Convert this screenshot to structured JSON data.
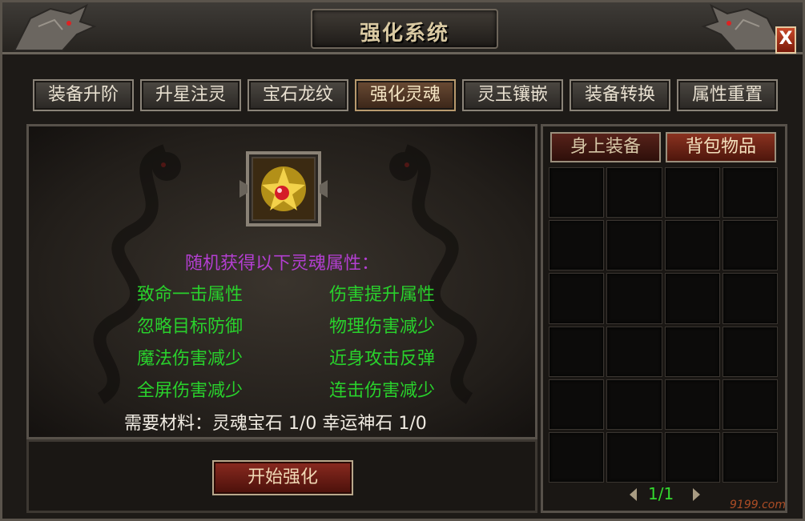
{
  "window": {
    "title": "强化系统",
    "close_label": "X"
  },
  "tabs": [
    {
      "label": "装备升阶",
      "active": false
    },
    {
      "label": "升星注灵",
      "active": false
    },
    {
      "label": "宝石龙纹",
      "active": false
    },
    {
      "label": "强化灵魂",
      "active": true
    },
    {
      "label": "灵玉镶嵌",
      "active": false
    },
    {
      "label": "装备转换",
      "active": false
    },
    {
      "label": "属性重置",
      "active": false
    }
  ],
  "main": {
    "attr_header": "随机获得以下灵魂属性：",
    "attributes": [
      "致命一击属性",
      "伤害提升属性",
      "忽略目标防御",
      "物理伤害减少",
      "魔法伤害减少",
      "近身攻击反弹",
      "全屏伤害减少",
      "连击伤害减少"
    ],
    "materials": "需要材料：灵魂宝石 1/0 幸运神石 1/0",
    "start_button": "开始强化",
    "item_icon": "golden-soul-gem-icon"
  },
  "side": {
    "tabs": [
      {
        "label": "身上装备",
        "active": false
      },
      {
        "label": "背包物品",
        "active": true
      }
    ],
    "grid_rows": 6,
    "grid_cols": 4,
    "page_indicator": "1/1"
  },
  "watermark": "9199.com",
  "colors": {
    "attribute_green": "#29d12c",
    "header_purple": "#b33fd1",
    "title_gold": "#d9c9a2"
  }
}
